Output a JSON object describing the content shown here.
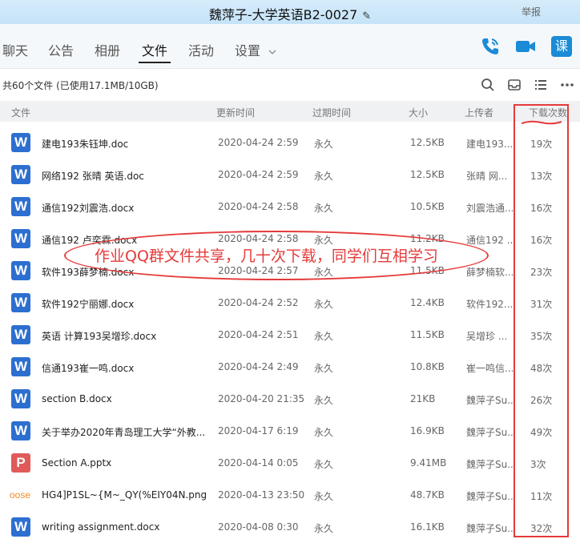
{
  "window": {
    "title": "魏萍子-大学英语B2-0027",
    "report_label": "举报",
    "minimize_label": "—",
    "maximize_label": "□",
    "close_label": "✕"
  },
  "tabs": [
    {
      "label": "聊天"
    },
    {
      "label": "公告"
    },
    {
      "label": "相册"
    },
    {
      "label": "文件"
    },
    {
      "label": "活动"
    },
    {
      "label": "设置"
    }
  ],
  "nav_icons": {
    "call": "phone-icon",
    "video": "video-camera-icon",
    "class_label": "课"
  },
  "storage_info": "共60个文件 (已使用17.1MB/10GB)",
  "toolbar_icons": [
    "search-icon",
    "inbox-icon",
    "list-view-icon",
    "more-icon"
  ],
  "columns": {
    "file": "文件",
    "updated": "更新时间",
    "expires": "过期时间",
    "size": "大小",
    "uploader": "上传者",
    "downloads": "下载次数"
  },
  "files": [
    {
      "icon": "W",
      "type": "word",
      "name": "建电193朱钰坤.doc",
      "updated": "2020-04-24 2:59",
      "expires": "永久",
      "size": "12.5KB",
      "uploader": "建电193...",
      "downloads": "19次"
    },
    {
      "icon": "W",
      "type": "word",
      "name": "网络192  张晴      英语.doc",
      "updated": "2020-04-24 2:59",
      "expires": "永久",
      "size": "12.5KB",
      "uploader": "张晴 网...",
      "downloads": "13次"
    },
    {
      "icon": "W",
      "type": "word",
      "name": "通信192刘震浩.docx",
      "updated": "2020-04-24 2:58",
      "expires": "永久",
      "size": "10.5KB",
      "uploader": "刘震浩通...",
      "downloads": "16次"
    },
    {
      "icon": "W",
      "type": "word",
      "name": "通信192 卢奕霖.docx",
      "updated": "2020-04-24 2:58",
      "expires": "永久",
      "size": "11.2KB",
      "uploader": "通信192 ...",
      "downloads": "16次"
    },
    {
      "icon": "W",
      "type": "word",
      "name": "软件193薛梦楠.docx",
      "updated": "2020-04-24 2:57",
      "expires": "永久",
      "size": "11.5KB",
      "uploader": "薛梦楠软...",
      "downloads": "23次"
    },
    {
      "icon": "W",
      "type": "word",
      "name": "软件192宁丽娜.docx",
      "updated": "2020-04-24 2:52",
      "expires": "永久",
      "size": "12.4KB",
      "uploader": "软件192...",
      "downloads": "31次"
    },
    {
      "icon": "W",
      "type": "word",
      "name": "英语 计算193吴增珍.docx",
      "updated": "2020-04-24 2:51",
      "expires": "永久",
      "size": "11.5KB",
      "uploader": "吴增珍 ...",
      "downloads": "35次"
    },
    {
      "icon": "W",
      "type": "word",
      "name": "信通193崔一鸣.docx",
      "updated": "2020-04-24 2:49",
      "expires": "永久",
      "size": "10.8KB",
      "uploader": "崔一鸣信...",
      "downloads": "48次"
    },
    {
      "icon": "W",
      "type": "word",
      "name": "section B.docx",
      "updated": "2020-04-20 21:35",
      "expires": "永久",
      "size": "21KB",
      "uploader": "魏萍子Su...",
      "downloads": "26次"
    },
    {
      "icon": "W",
      "type": "word",
      "name": "关于举办2020年青岛理工大学“外教...",
      "updated": "2020-04-17 6:19",
      "expires": "永久",
      "size": "16.9KB",
      "uploader": "魏萍子Su...",
      "downloads": "49次"
    },
    {
      "icon": "P",
      "type": "ppt",
      "name": "Section A.pptx",
      "updated": "2020-04-14 0:05",
      "expires": "永久",
      "size": "9.41MB",
      "uploader": "魏萍子Su...",
      "downloads": "3次"
    },
    {
      "icon": "oose i",
      "type": "image",
      "name": "HG4]P1SL~{M~_QY(%EIY04N.png",
      "updated": "2020-04-13 23:50",
      "expires": "永久",
      "size": "48.7KB",
      "uploader": "魏萍子Su...",
      "downloads": "11次"
    },
    {
      "icon": "W",
      "type": "word",
      "name": "writing assignment.docx",
      "updated": "2020-04-08 0:30",
      "expires": "永久",
      "size": "16.1KB",
      "uploader": "魏萍子Su...",
      "downloads": "32次"
    }
  ],
  "annotation": {
    "text": "作业QQ群文件共享，几十次下载，同学们互相学习",
    "color": "#e53a3a"
  },
  "colors": {
    "accent": "#1a8bd6",
    "word": "#2d6fd1",
    "ppt": "#e05a5a"
  }
}
